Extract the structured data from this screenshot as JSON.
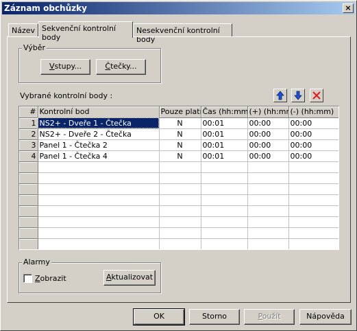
{
  "window": {
    "title": "Záznam obchůzky",
    "close_glyph": "×"
  },
  "tabs": [
    {
      "label": "Název",
      "active": false
    },
    {
      "label": "Sekvenční kontrolní body",
      "active": true
    },
    {
      "label": "Nesekvenční kontrolní body",
      "active": false
    }
  ],
  "vyber": {
    "label": "Výběr",
    "vstupy": {
      "prefix": "",
      "mnemonic": "V",
      "rest": "stupy..."
    },
    "ctecky": {
      "prefix": "",
      "mnemonic": "Č",
      "rest": "tečky..."
    }
  },
  "selected_points_label": "Vybrané kontrolní body :",
  "toolbar": {
    "up_icon": "arrow-up-icon",
    "down_icon": "arrow-down-icon",
    "delete_icon": "delete-x-icon"
  },
  "grid": {
    "columns": [
      "#",
      "Kontrolní bod",
      "Pouze platné",
      "Čas (hh:mm)",
      "(+)  (hh:mm)",
      "(-)  (hh:mm)"
    ],
    "rows": [
      {
        "num": "1",
        "name": "NS2+ - Dveře 1 - Čtečka",
        "only_valid": "N",
        "time": "00:01",
        "plus": "00:00",
        "minus": "00:00"
      },
      {
        "num": "2",
        "name": "NS2+ - Dveře 2 - Čtečka",
        "only_valid": "N",
        "time": "00:01",
        "plus": "00:00",
        "minus": "00:00"
      },
      {
        "num": "3",
        "name": "Panel 1 - Čtečka 2",
        "only_valid": "N",
        "time": "00:01",
        "plus": "00:00",
        "minus": "00:00"
      },
      {
        "num": "4",
        "name": "Panel 1 - Čtečka 4",
        "only_valid": "N",
        "time": "00:01",
        "plus": "00:00",
        "minus": "00:00"
      }
    ],
    "selected_row": 0
  },
  "alarmy": {
    "label": "Alarmy",
    "zobrazit": {
      "prefix": "",
      "mnemonic": "Z",
      "rest": "obrazit",
      "checked": false
    },
    "aktualizovat": {
      "prefix": "",
      "mnemonic": "A",
      "rest": "ktualizovat"
    }
  },
  "footer": {
    "ok": "OK",
    "storno": "Storno",
    "pouzit": {
      "prefix": "",
      "mnemonic": "P",
      "rest": "oužít"
    },
    "napoveda": "Nápověda"
  }
}
